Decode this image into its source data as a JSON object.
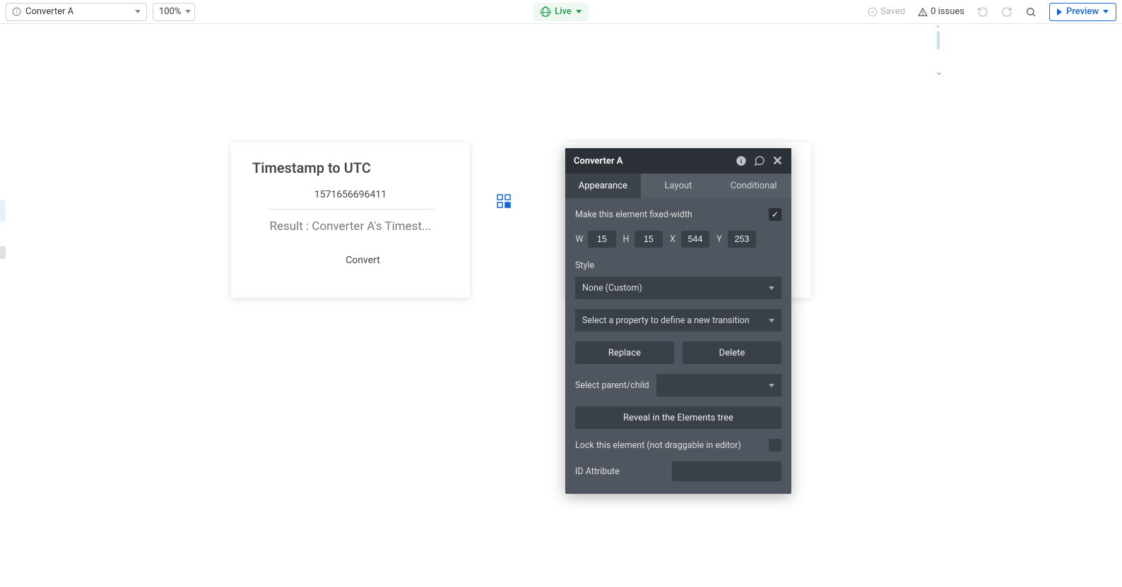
{
  "topbar": {
    "page_name": "Converter A",
    "zoom": "100%",
    "live_label": "Live",
    "saved_label": "Saved",
    "issues_count": "0 issues",
    "preview_label": "Preview"
  },
  "card": {
    "title": "Timestamp to UTC",
    "timestamp": "1571656696411",
    "result": "Result : Converter A's Timest...",
    "convert_label": "Convert"
  },
  "panel": {
    "title": "Converter A",
    "tabs": {
      "appearance": "Appearance",
      "layout": "Layout",
      "conditional": "Conditional"
    },
    "fixed_width_label": "Make this element fixed-width",
    "fixed_width_checked": true,
    "dims": {
      "W": "15",
      "H": "15",
      "X": "544",
      "Y": "253"
    },
    "style_label": "Style",
    "style_value": "None (Custom)",
    "transition_placeholder": "Select a property to define a new transition",
    "replace_label": "Replace",
    "delete_label": "Delete",
    "parent_label": "Select parent/child",
    "reveal_label": "Reveal in the Elements tree",
    "lock_label": "Lock this element (not draggable in editor)",
    "lock_checked": false,
    "idattr_label": "ID Attribute",
    "idattr_value": ""
  }
}
